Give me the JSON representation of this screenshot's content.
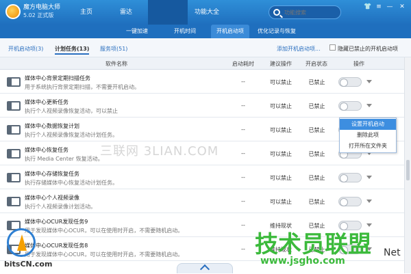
{
  "app": {
    "title": "魔方电脑大师",
    "version": "5.02 正式版"
  },
  "nav": {
    "tabs": [
      {
        "label": "主页"
      },
      {
        "label": "雷达"
      },
      {
        "label": "功能大全"
      }
    ]
  },
  "search": {
    "placeholder": "功能搜索"
  },
  "window": {
    "skin": "👕",
    "menu": "≡",
    "minimize": "—",
    "close": "✕"
  },
  "subnav": {
    "tabs": [
      {
        "label": "一键加速"
      },
      {
        "label": "开机时间"
      },
      {
        "label": "开机启动项"
      },
      {
        "label": "优化记录与恢复"
      }
    ]
  },
  "filter": {
    "tabs": [
      {
        "label": "开机启动项(3)"
      },
      {
        "label": "计划任务(13)"
      },
      {
        "label": "服务项(51)"
      }
    ],
    "add_link": "添加开机启动项...",
    "hide_label": "隐藏已禁止的开机启动项"
  },
  "table": {
    "headers": {
      "name": "软件名称",
      "time": "启动耗时",
      "advice": "建议操作",
      "status": "开启状态",
      "action": "操作"
    },
    "rows": [
      {
        "name": "媒体中心背景定期扫描任务",
        "desc": "用于系统执行背景定期扫描，不需要开机启动。",
        "time": "--",
        "advice": "可以禁止",
        "status": "已禁止"
      },
      {
        "name": "媒体中心更新任务",
        "desc": "执行个人视频录像恢复活动，可以禁止",
        "time": "--",
        "advice": "可以禁止",
        "status": "已禁止"
      },
      {
        "name": "媒体中心数据恢复计划",
        "desc": "执行个人视频录像恢复活动计划任务。",
        "time": "--",
        "advice": "可以禁止",
        "status": "已禁止"
      },
      {
        "name": "媒体中心恢复任务",
        "desc": "执行 Media Center 恢复活动。",
        "time": "--",
        "advice": "可以禁止",
        "status": "已禁止"
      },
      {
        "name": "媒体中心存储恢复任务",
        "desc": "执行存储媒体中心恢复活动计划任务。",
        "time": "--",
        "advice": "可以禁止",
        "status": "已禁止"
      },
      {
        "name": "媒体中心个人视频录像",
        "desc": "执行个人视频录像计划活动。",
        "time": "--",
        "advice": "可以禁止",
        "status": "已禁止"
      },
      {
        "name": "媒体中心OCUR发现任务9",
        "desc": "用于发现媒体中心OCUR，可以在使用时开启，不需要随机启动。",
        "time": "--",
        "advice": "维持现状",
        "status": "已禁止"
      },
      {
        "name": "媒体中心OCUR发现任务8",
        "desc": "用于发现媒体中心OCUR，可以在使用时开启，不需要随机启动。",
        "time": "--",
        "advice": "维持现状",
        "status": "已禁止"
      }
    ]
  },
  "context_menu": {
    "items": [
      {
        "label": "设置开机启动"
      },
      {
        "label": "删除此项"
      },
      {
        "label": "打开所在文件夹"
      }
    ]
  },
  "watermarks": {
    "center": "三联网 3LIAN.COM",
    "brand_cn": "技术员联盟",
    "brand_url": "www.jsgho.com",
    "brand_net": "Net",
    "site": "bitsCN.com"
  }
}
